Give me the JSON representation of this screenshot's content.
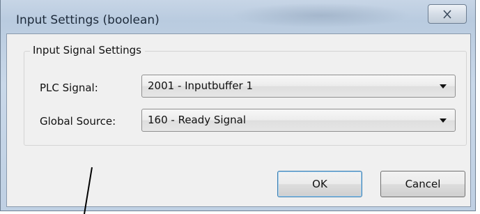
{
  "window": {
    "title": "Input Settings (boolean)",
    "close_icon": "close-icon"
  },
  "group": {
    "legend": "Input Signal Settings"
  },
  "fields": {
    "plc_signal": {
      "label": "PLC Signal:",
      "value": "2001 - Inputbuffer 1"
    },
    "global_source": {
      "label": "Global Source:",
      "value": "160 - Ready Signal"
    }
  },
  "buttons": {
    "ok": "OK",
    "cancel": "Cancel"
  },
  "icons": {
    "dropdown": "chevron-down-icon"
  }
}
